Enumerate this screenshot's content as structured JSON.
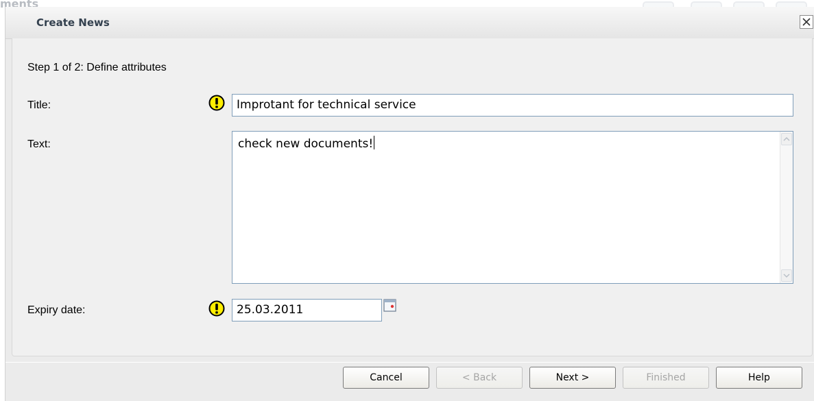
{
  "background": {
    "fragment_text": "ments"
  },
  "dialog": {
    "title": "Create News",
    "close_glyph": "×"
  },
  "form": {
    "step": "Step 1 of 2: Define attributes",
    "title_label": "Title:",
    "title_value": "Improtant for technical service",
    "text_label": "Text:",
    "text_value": "check new documents!",
    "expiry_label": "Expiry date:",
    "expiry_value": "25.03.2011"
  },
  "buttons": {
    "cancel": "Cancel",
    "back": "< Back",
    "next": "Next >",
    "finished": "Finished",
    "help": "Help"
  },
  "icons": {
    "warning": "warning-icon",
    "calendar": "calendar-icon",
    "close": "close-icon"
  },
  "colors": {
    "warning_fill": "#ffee00",
    "dialog_bg": "#ebebeb",
    "title_text": "#34414f"
  }
}
